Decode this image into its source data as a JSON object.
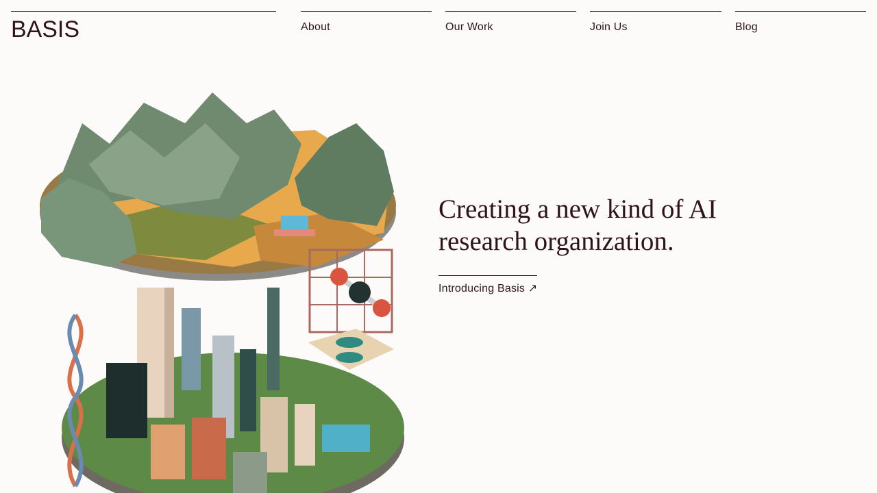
{
  "brand": {
    "logo_text": "BASIS",
    "color": "#2e1418"
  },
  "nav": {
    "items": [
      {
        "label": "About"
      },
      {
        "label": "Our Work"
      },
      {
        "label": "Join Us"
      },
      {
        "label": "Blog"
      }
    ]
  },
  "hero": {
    "headline_line1": "Creating a new kind of AI",
    "headline_line2": "research organization.",
    "cta_label": "Introducing Basis ↗"
  },
  "colors": {
    "background": "#fdfbfa",
    "text": "#2e1418",
    "mountain": "#6f8a6e",
    "field": "#e8a94c",
    "grass": "#5e8a48",
    "accent_red": "#d9553f"
  }
}
